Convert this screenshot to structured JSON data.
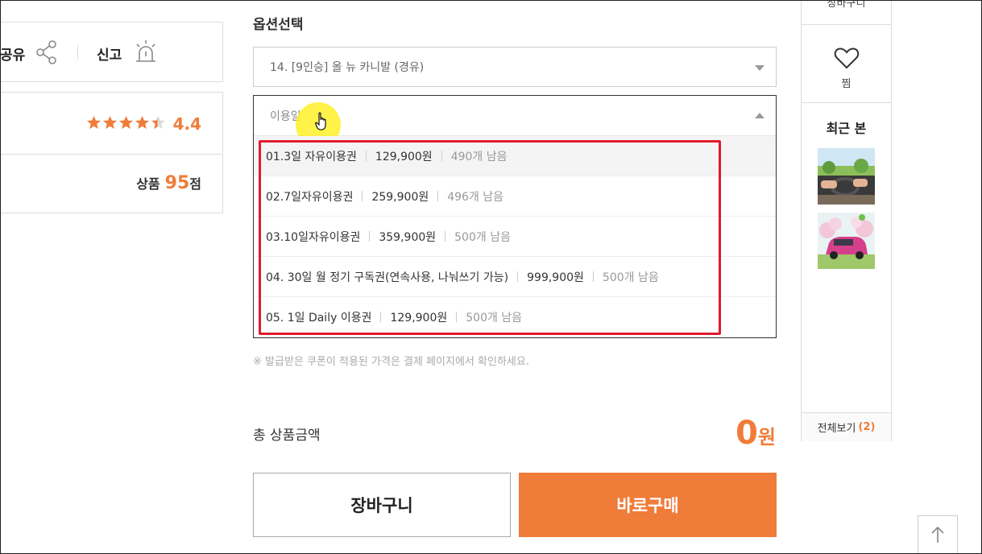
{
  "left_panel": {
    "share_label": "공유",
    "report_label": "신고",
    "rating_value": "4.4",
    "rating_stars": 4.4,
    "product_label": "상품",
    "product_score": "95",
    "product_unit": "점"
  },
  "options": {
    "title": "옵션선택",
    "select1_value": "14. [9인승] 올 뉴 카니발 (경유)",
    "select2_placeholder": "이용일",
    "items": [
      {
        "name": "01.3일 자유이용권",
        "price": "129,900원",
        "stock": "490개 남음"
      },
      {
        "name": "02.7일자유이용권",
        "price": "259,900원",
        "stock": "496개 남음"
      },
      {
        "name": "03.10일자유이용권",
        "price": "359,900원",
        "stock": "500개 남음"
      },
      {
        "name": "04. 30일 월 정기 구독권(연속사용, 나눠쓰기 가능)",
        "price": "999,900원",
        "stock": "500개 남음"
      },
      {
        "name": "05. 1일 Daily 이용권",
        "price": "129,900원",
        "stock": "500개 남음"
      }
    ],
    "notice": "※ 발급받은 쿠폰이 적용된 가격은 결제 페이지에서 확인하세요."
  },
  "total": {
    "label": "총 상품금액",
    "amount": "0",
    "unit": "원"
  },
  "buttons": {
    "cart": "장바구니",
    "buy": "바로구매"
  },
  "sidebar": {
    "cart_label": "장바구니",
    "wish_label": "찜",
    "recent_title": "최근 본",
    "view_all_label": "전체보기",
    "view_all_count": "(2)"
  },
  "colors": {
    "accent": "#f07c3a",
    "highlight_box": "#e01b2e"
  }
}
